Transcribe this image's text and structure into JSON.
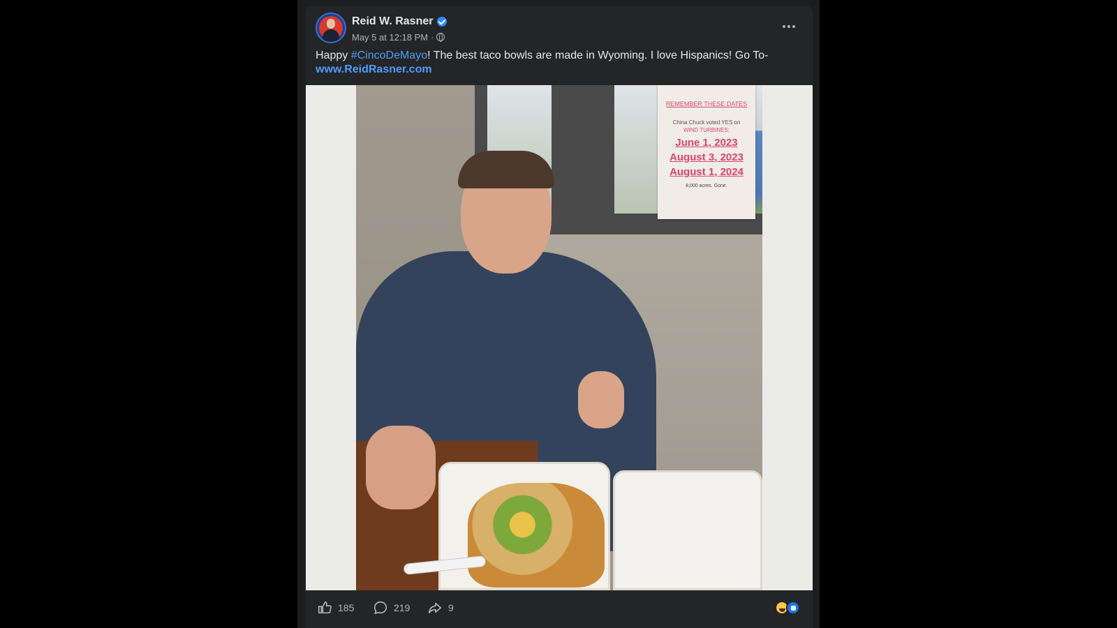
{
  "post": {
    "author": "Reid W. Rasner",
    "timestamp": "May 5 at 12:18 PM",
    "separator": "·",
    "text": {
      "before": "Happy ",
      "hashtag": "#CincoDeMayo",
      "after": "! The best taco bowls are made in Wyoming. I love Hispanics! Go To-",
      "link": "www.ReidRasner.com"
    }
  },
  "photo": {
    "poster": {
      "heading": "REMEMBER THESE DATES",
      "line1": "China Chuck voted YES on",
      "line2": "WIND TURBINES:",
      "dates": [
        "June 1, 2023",
        "August 3, 2023",
        "August 1, 2024"
      ],
      "footer": "8,000 acres. Gone."
    }
  },
  "actions": {
    "likes": "185",
    "comments": "219",
    "shares": "9"
  },
  "icons": {
    "verified": "verified-badge-icon",
    "audience": "globe-icon",
    "more": "more-options-icon",
    "like": "thumbs-up-icon",
    "comment": "comment-bubble-icon",
    "share": "share-arrow-icon",
    "reactions": [
      "haha-reaction-icon",
      "like-reaction-icon"
    ]
  },
  "colors": {
    "background": "#000000",
    "card": "#242526",
    "text": "#e4e6eb",
    "secondary_text": "#b0b3b8",
    "link": "#4d9ef7",
    "verified": "#2d88ff"
  }
}
